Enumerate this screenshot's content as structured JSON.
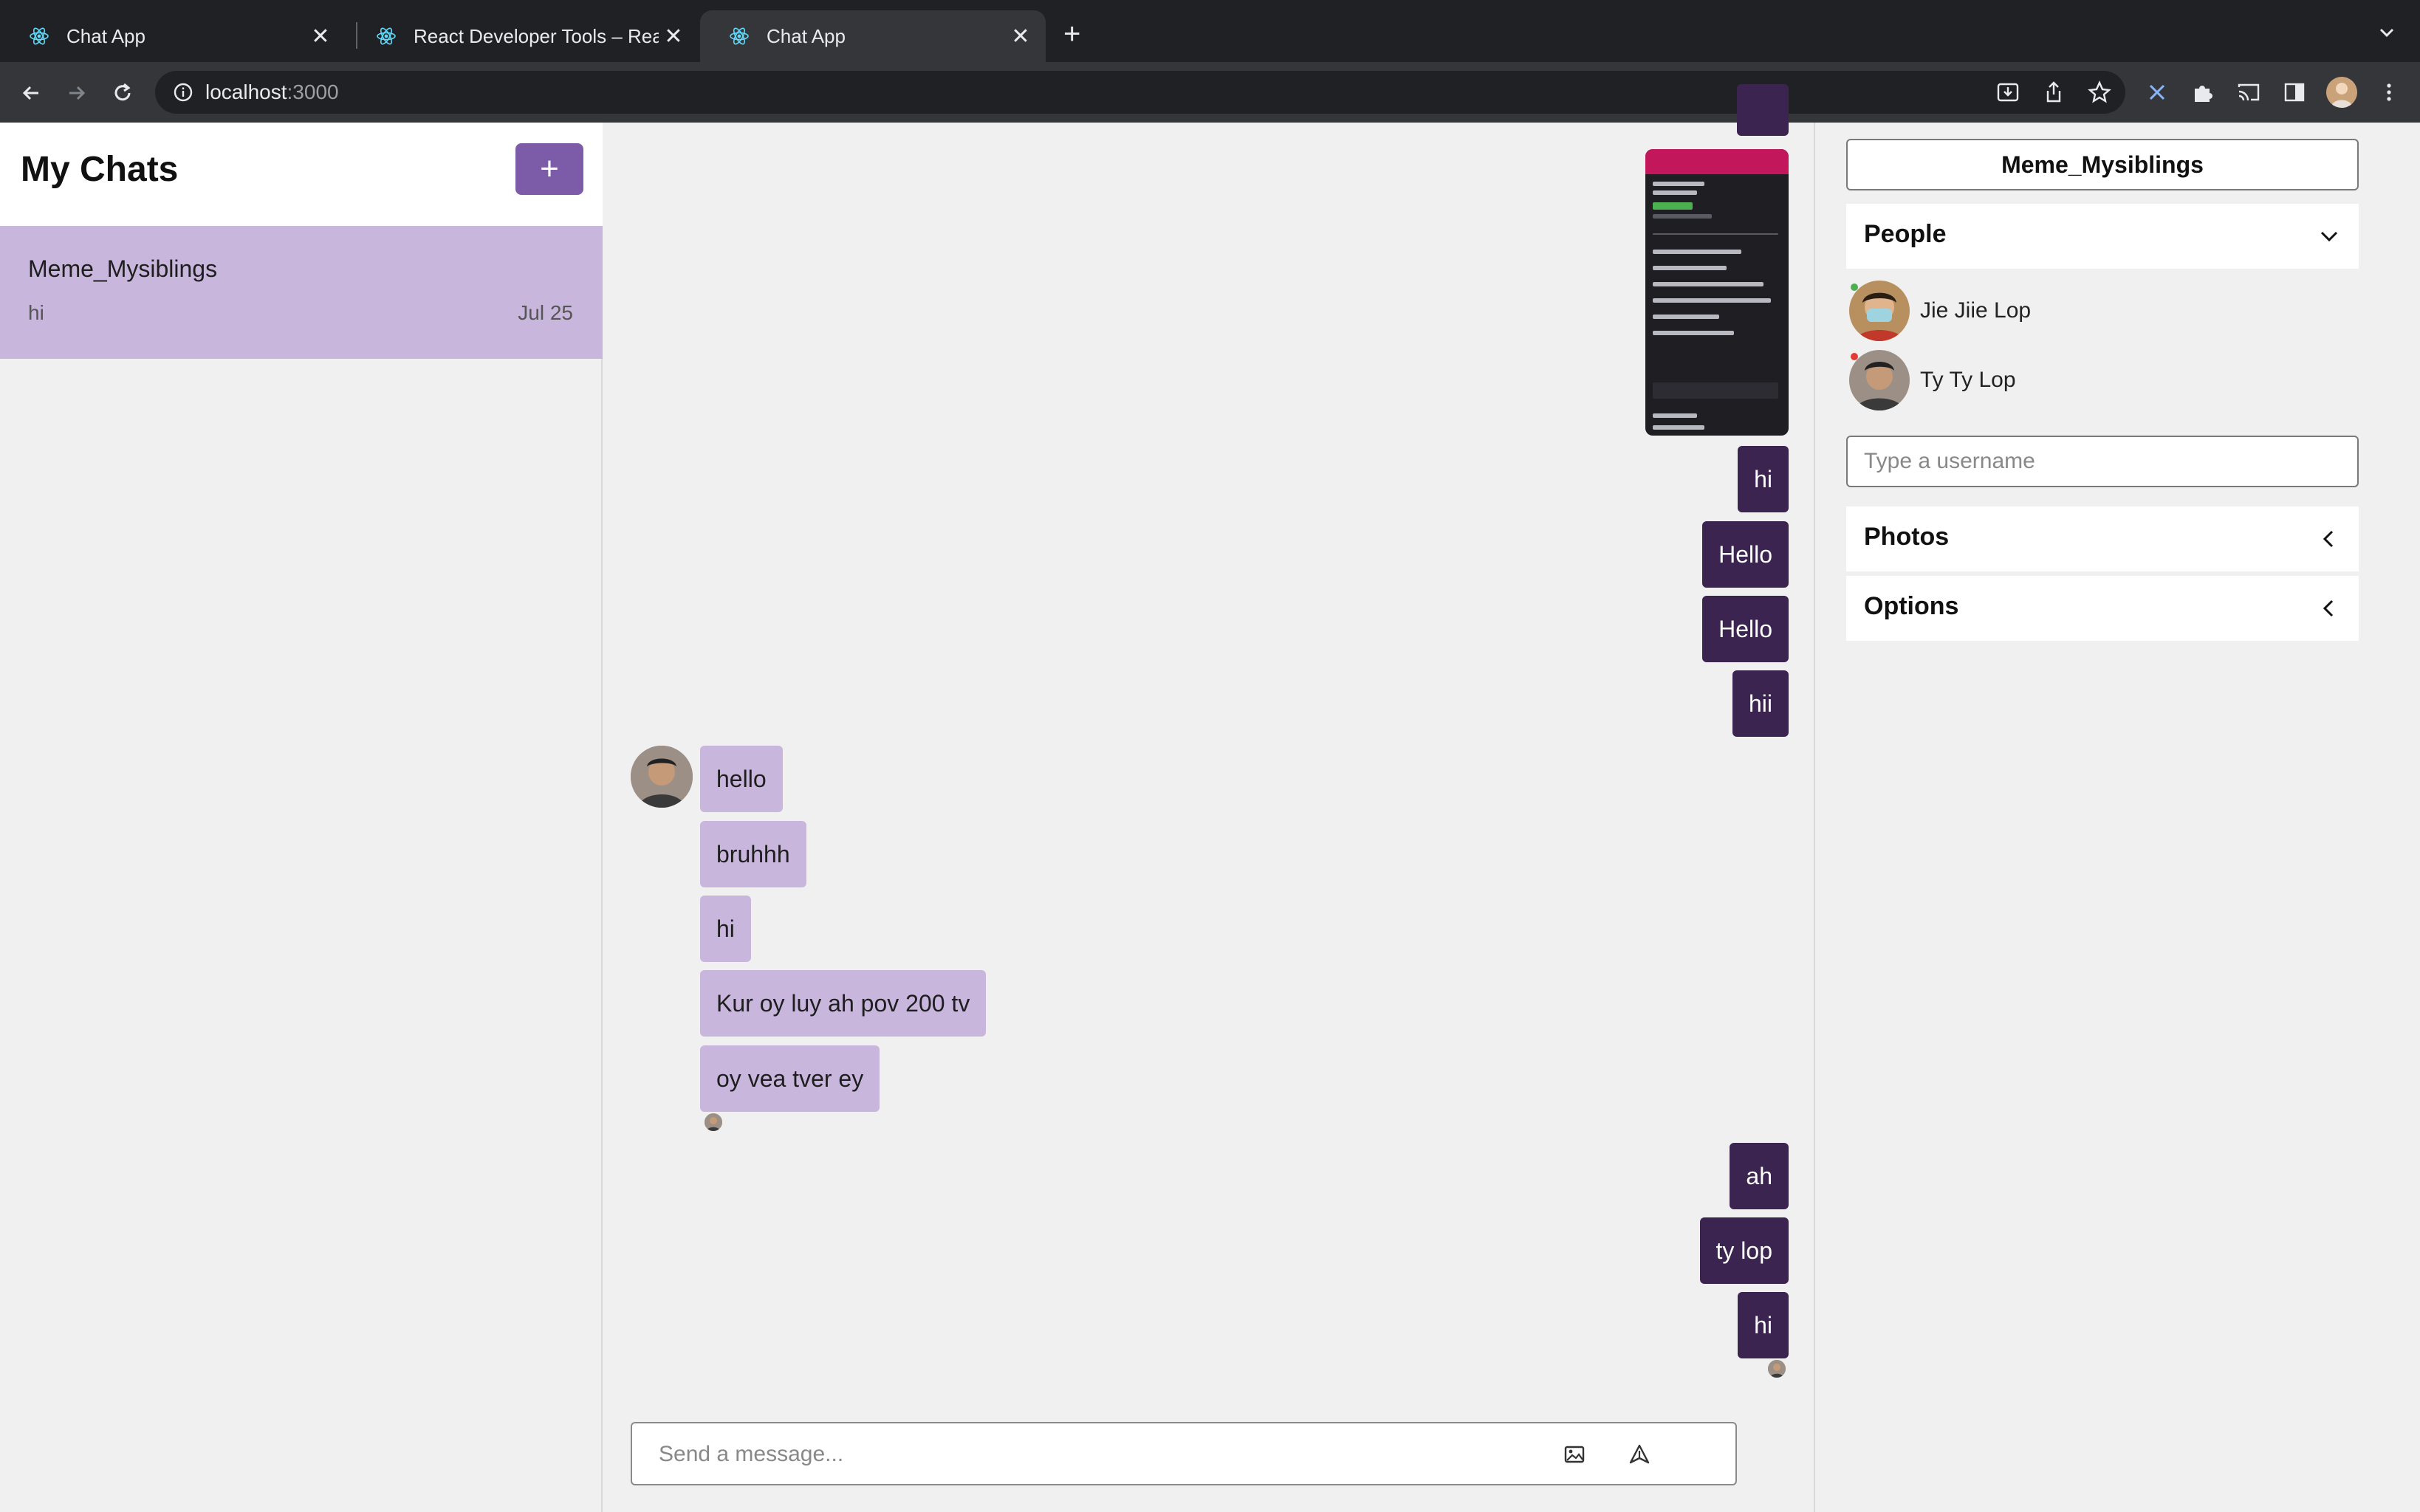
{
  "browser": {
    "tabs": [
      {
        "title": "Chat App"
      },
      {
        "title": "React Developer Tools – React"
      },
      {
        "title": "Chat App"
      }
    ],
    "url_host": "localhost",
    "url_port": ":3000"
  },
  "sidebar": {
    "title": "My Chats",
    "add_label": "+",
    "chats": [
      {
        "name": "Meme_Mysiblings",
        "preview": "hi",
        "date": "Jul 25"
      }
    ]
  },
  "feed": {
    "messages_mine_top": [
      "hi",
      "Hello",
      "Hello",
      "hii"
    ],
    "messages_theirs": [
      "hello",
      "bruhhh",
      "hi",
      "Kur oy luy ah pov 200 tv",
      "oy vea tver ey"
    ],
    "messages_mine_bottom": [
      "ah",
      "ty lop",
      "hi"
    ],
    "composer_placeholder": "Send a message..."
  },
  "details": {
    "chat_title": "Meme_Mysiblings",
    "people_label": "People",
    "people": [
      {
        "name": "Jie Jiie Lop",
        "status_color": "#4caf50"
      },
      {
        "name": "Ty Ty Lop",
        "status_color": "#e53935"
      }
    ],
    "username_placeholder": "Type a username",
    "photos_label": "Photos",
    "options_label": "Options"
  },
  "colors": {
    "accent": "#7c5ca8",
    "my_bubble": "#3b2450",
    "their_bubble": "#c8b6dc"
  }
}
